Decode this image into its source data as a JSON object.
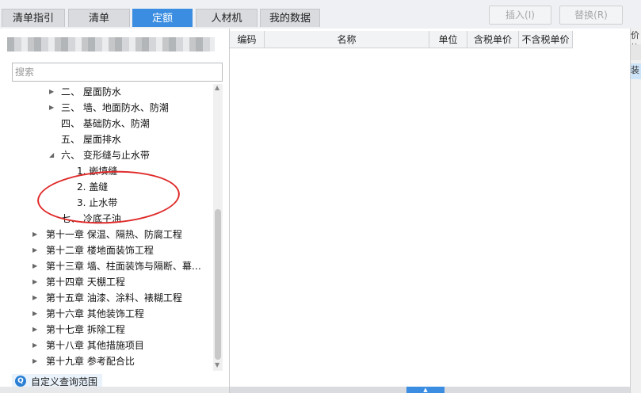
{
  "tabs": [
    {
      "label": "清单指引",
      "active": false
    },
    {
      "label": "清单",
      "active": false
    },
    {
      "label": "定额",
      "active": true
    },
    {
      "label": "人材机",
      "active": false
    },
    {
      "label": "我的数据",
      "active": false
    }
  ],
  "toolbar": {
    "insert_label": "插入(I)",
    "replace_label": "替换(R)"
  },
  "right_strip": {
    "top_text": "价格",
    "cell_text": "装"
  },
  "search": {
    "placeholder": "搜索"
  },
  "tree": [
    {
      "label": "二、  屋面防水",
      "collapsed": true
    },
    {
      "label": "三、  墙、地面防水、防潮",
      "collapsed": true
    },
    {
      "label": "四、  基础防水、防潮",
      "collapsed": null
    },
    {
      "label": "五、  屋面排水",
      "collapsed": null
    },
    {
      "label": "六、  变形缝与止水带",
      "collapsed": false
    },
    {
      "label": "1.  嵌填缝",
      "collapsed": null
    },
    {
      "label": "2.  盖缝",
      "collapsed": null
    },
    {
      "label": "3.  止水带",
      "collapsed": null
    },
    {
      "label": "七、  冷底子油",
      "collapsed": null
    },
    {
      "label": "第十一章  保温、隔热、防腐工程",
      "collapsed": true
    },
    {
      "label": "第十二章  楼地面装饰工程",
      "collapsed": true
    },
    {
      "label": "第十三章  墙、柱面装饰与隔断、幕…",
      "collapsed": true
    },
    {
      "label": "第十四章  天棚工程",
      "collapsed": true
    },
    {
      "label": "第十五章  油漆、涂料、裱糊工程",
      "collapsed": true
    },
    {
      "label": "第十六章  其他装饰工程",
      "collapsed": true
    },
    {
      "label": "第十七章  拆除工程",
      "collapsed": true
    },
    {
      "label": "第十八章  其他措施项目",
      "collapsed": true
    },
    {
      "label": "第十九章  参考配合比",
      "collapsed": true
    }
  ],
  "custom_query": {
    "label": "自定义查询范围",
    "icon": "search-icon"
  },
  "table": {
    "columns": [
      "编码",
      "名称",
      "单位",
      "含税单价",
      "不含税单价"
    ],
    "rows": []
  },
  "colors": {
    "accent": "#3a8de0",
    "annotation": "#e02a2a"
  }
}
